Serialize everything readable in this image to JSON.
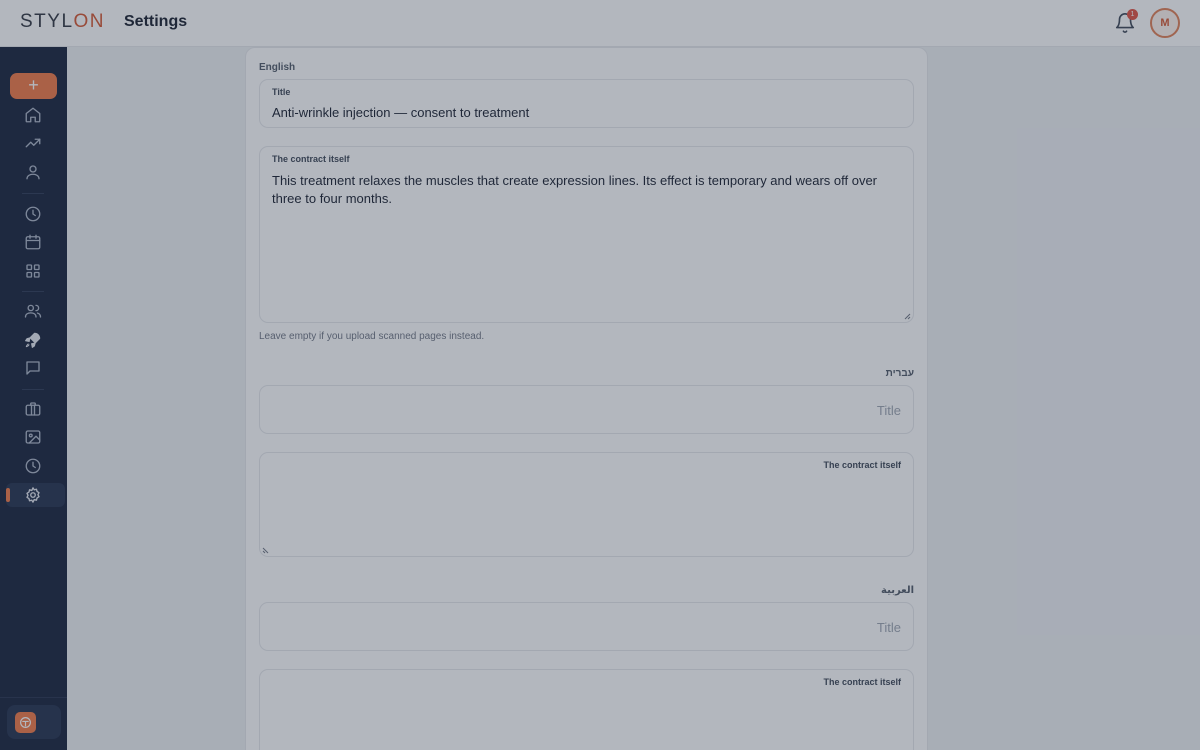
{
  "app": {
    "logo_prefix": "STYL",
    "logo_suffix": "ON",
    "page_title": "Settings"
  },
  "header": {
    "notification_count": "1",
    "avatar_initial": "M"
  },
  "sidebar": {
    "add_label": "+",
    "icons": [
      "home-icon",
      "trending-icon",
      "user-icon",
      "clock-icon",
      "calendar-icon",
      "grid-icon",
      "users-icon",
      "rocket-icon",
      "message-icon",
      "briefcase-icon",
      "image-icon",
      "history-icon",
      "gear-icon"
    ],
    "active": "gear-icon"
  },
  "form": {
    "english": {
      "section": "English",
      "title_label": "Title",
      "title_value": "Anti-wrinkle injection — consent to treatment",
      "contract_label": "The contract itself",
      "contract_value": "This treatment relaxes the muscles that create expression lines. Its effect is temporary and wears off over three to four months.",
      "hint": "Leave empty if you upload scanned pages instead."
    },
    "hebrew": {
      "section": "עברית",
      "title_placeholder": "Title",
      "contract_label": "The contract itself"
    },
    "arabic": {
      "section": "العربية",
      "title_placeholder": "Title",
      "contract_label": "The contract itself"
    }
  },
  "colors": {
    "accent": "#f0743f",
    "sidebar_bg": "#0f1b35"
  }
}
